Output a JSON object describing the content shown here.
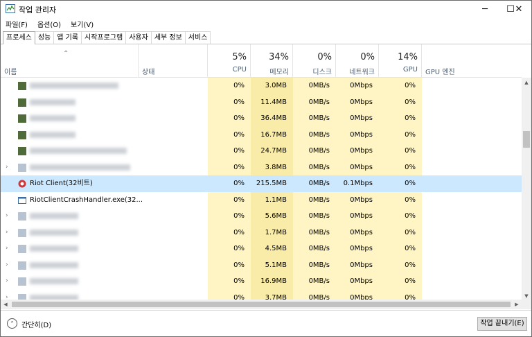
{
  "window": {
    "title": "작업 관리자",
    "min_icon": "minimize-icon",
    "max_icon": "maximize-icon",
    "close_icon": "close-icon"
  },
  "menu": [
    "파일(F)",
    "옵션(O)",
    "보기(V)"
  ],
  "tabs": [
    "프로세스",
    "성능",
    "앱 기록",
    "시작프로그램",
    "사용자",
    "세부 정보",
    "서비스"
  ],
  "header": {
    "name": "이름",
    "status": "상태",
    "cpu": {
      "pct": "5%",
      "label": "CPU"
    },
    "memory": {
      "pct": "34%",
      "label": "메모리"
    },
    "disk": {
      "pct": "0%",
      "label": "디스크"
    },
    "network": {
      "pct": "0%",
      "label": "네트워크"
    },
    "gpu": {
      "pct": "14%",
      "label": "GPU"
    },
    "gpu_engine": "GPU 엔진"
  },
  "rows": [
    {
      "name": "",
      "cpu": "0%",
      "mem": "3.0MB",
      "disk": "0MB/s",
      "net": "0Mbps",
      "gpu": "0%"
    },
    {
      "name": "",
      "cpu": "0%",
      "mem": "11.4MB",
      "disk": "0MB/s",
      "net": "0Mbps",
      "gpu": "0%"
    },
    {
      "name": "",
      "cpu": "0%",
      "mem": "36.4MB",
      "disk": "0MB/s",
      "net": "0Mbps",
      "gpu": "0%"
    },
    {
      "name": "",
      "cpu": "0%",
      "mem": "16.7MB",
      "disk": "0MB/s",
      "net": "0Mbps",
      "gpu": "0%"
    },
    {
      "name": "",
      "cpu": "0%",
      "mem": "24.7MB",
      "disk": "0MB/s",
      "net": "0Mbps",
      "gpu": "0%"
    },
    {
      "name": "",
      "cpu": "0%",
      "mem": "3.8MB",
      "disk": "0MB/s",
      "net": "0Mbps",
      "gpu": "0%"
    },
    {
      "name": "Riot Client(32비트)",
      "cpu": "0%",
      "mem": "215.5MB",
      "disk": "0MB/s",
      "net": "0.1Mbps",
      "gpu": "0%"
    },
    {
      "name": "RiotClientCrashHandler.exe(32...",
      "cpu": "0%",
      "mem": "1.1MB",
      "disk": "0MB/s",
      "net": "0Mbps",
      "gpu": "0%"
    },
    {
      "name": "",
      "cpu": "0%",
      "mem": "5.6MB",
      "disk": "0MB/s",
      "net": "0Mbps",
      "gpu": "0%"
    },
    {
      "name": "",
      "cpu": "0%",
      "mem": "1.7MB",
      "disk": "0MB/s",
      "net": "0Mbps",
      "gpu": "0%"
    },
    {
      "name": "",
      "cpu": "0%",
      "mem": "4.5MB",
      "disk": "0MB/s",
      "net": "0Mbps",
      "gpu": "0%"
    },
    {
      "name": "",
      "cpu": "0%",
      "mem": "5.1MB",
      "disk": "0MB/s",
      "net": "0Mbps",
      "gpu": "0%"
    },
    {
      "name": "",
      "cpu": "0%",
      "mem": "16.9MB",
      "disk": "0MB/s",
      "net": "0Mbps",
      "gpu": "0%"
    },
    {
      "name": "",
      "cpu": "0%",
      "mem": "3.7MB",
      "disk": "0MB/s",
      "net": "0Mbps",
      "gpu": "0%"
    }
  ],
  "footer": {
    "collapse_label": "간단히(D)",
    "end_task_label": "작업 끝내기(E)"
  }
}
